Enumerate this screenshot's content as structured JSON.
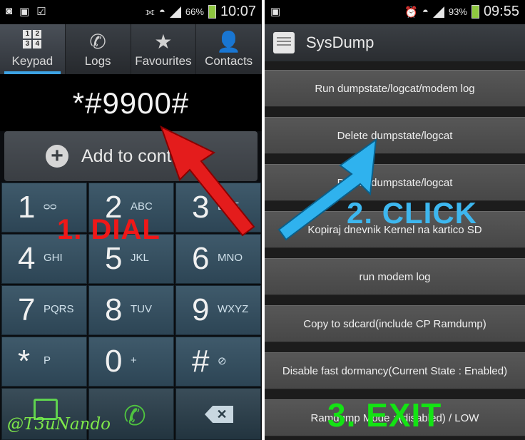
{
  "left": {
    "status": {
      "battery_pct": "66%",
      "time": "10:07"
    },
    "tabs": [
      {
        "label": "Keypad",
        "icon": "keypad-icon",
        "active": true
      },
      {
        "label": "Logs",
        "icon": "phone-log-icon"
      },
      {
        "label": "Favourites",
        "icon": "star-icon"
      },
      {
        "label": "Contacts",
        "icon": "person-icon"
      }
    ],
    "dialed": "*#9900#",
    "add_contact_label": "Add to contacts",
    "keys": [
      {
        "num": "1",
        "letters": "voicemail-icon"
      },
      {
        "num": "2",
        "letters": "ABC"
      },
      {
        "num": "3",
        "letters": "DEF"
      },
      {
        "num": "4",
        "letters": "GHI"
      },
      {
        "num": "5",
        "letters": "JKL"
      },
      {
        "num": "6",
        "letters": "MNO"
      },
      {
        "num": "7",
        "letters": "PQRS"
      },
      {
        "num": "8",
        "letters": "TUV"
      },
      {
        "num": "9",
        "letters": "WXYZ"
      },
      {
        "num": "*",
        "letters": "P"
      },
      {
        "num": "0",
        "letters": "+"
      },
      {
        "num": "#",
        "letters": "mute-icon"
      }
    ],
    "annotation": "1. DIAL",
    "watermark": "@T3uNando"
  },
  "right": {
    "status": {
      "battery_pct": "93%",
      "time": "09:55"
    },
    "app_title": "SysDump",
    "buttons": [
      "Run dumpstate/logcat/modem log",
      "Delete dumpstate/logcat",
      "Delete dumpstate/logcat",
      "Kopiraj dnevnik Kernel na kartico SD",
      "run modem log",
      "Copy to sdcard(include CP Ramdump)",
      "Disable fast dormancy(Current State : Enabled)",
      "Ramdump Mode : (disabled) / LOW"
    ],
    "annotation_click": "2. CLICK",
    "annotation_exit": "3. EXIT"
  },
  "colors": {
    "red_annotation": "#f01818",
    "blue_annotation": "#3db7ef",
    "green_annotation": "#14e314",
    "tab_accent": "#3da3e4",
    "call_green": "#4fc43f"
  }
}
